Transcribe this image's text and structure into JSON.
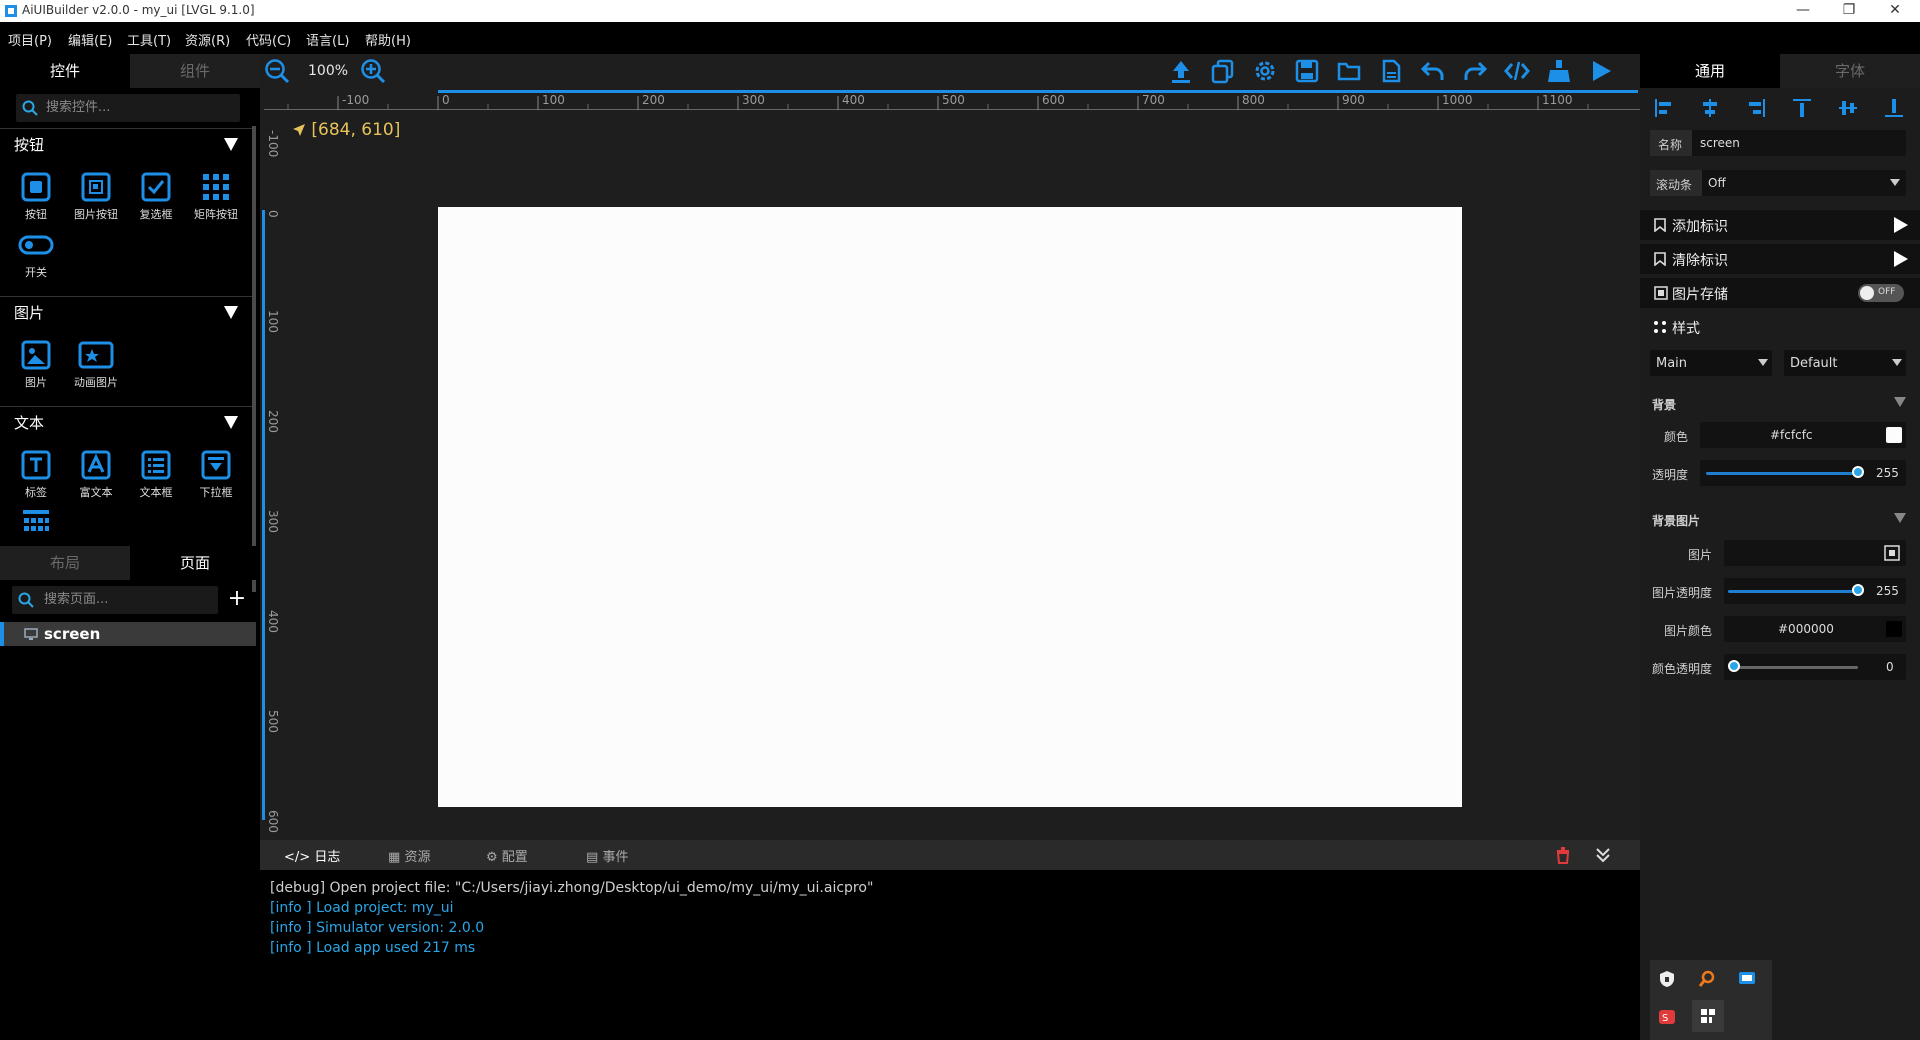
{
  "window": {
    "title": "AiUIBuilder v2.0.0 - my_ui [LVGL 9.1.0]"
  },
  "menu": [
    "项目(P)",
    "编辑(E)",
    "工具(T)",
    "资源(R)",
    "代码(C)",
    "语言(L)",
    "帮助(H)"
  ],
  "left": {
    "tabs": [
      "控件",
      "组件"
    ],
    "search_placeholder": "搜索控件...",
    "sections": [
      {
        "title": "按钮",
        "items": [
          "按钮",
          "图片按钮",
          "复选框",
          "矩阵按钮",
          "开关"
        ]
      },
      {
        "title": "图片",
        "items": [
          "图片",
          "动画图片"
        ]
      },
      {
        "title": "文本",
        "items": [
          "标签",
          "富文本",
          "文本框",
          "下拉框"
        ]
      }
    ],
    "bottom_tabs": [
      "布局",
      "页面"
    ],
    "page_search_placeholder": "搜索页面...",
    "pages": [
      "screen"
    ]
  },
  "toolbar": {
    "zoom": "100%"
  },
  "canvas": {
    "coordinate": "[684, 610]",
    "h_ticks": [
      "-100",
      "0",
      "100",
      "200",
      "300",
      "400",
      "500",
      "600",
      "700",
      "800",
      "900",
      "1000",
      "1100"
    ],
    "v_ticks": [
      "-100",
      "0",
      "100",
      "200",
      "300",
      "400",
      "500",
      "600"
    ],
    "background_color": "#fcfcfc"
  },
  "bottom": {
    "tabs": [
      "日志",
      "资源",
      "配置",
      "事件"
    ],
    "log": [
      {
        "level": "debug",
        "text": "[debug] Open project file: \"C:/Users/jiayi.zhong/Desktop/ui_demo/my_ui/my_ui.aicpro\""
      },
      {
        "level": "info",
        "text": "[info ] Load project: my_ui"
      },
      {
        "level": "info",
        "text": "[info ] Simulator version: 2.0.0"
      },
      {
        "level": "info",
        "text": "[info ] Load app used 217 ms"
      }
    ]
  },
  "right": {
    "tabs": [
      "通用",
      "字体"
    ],
    "name_label": "名称",
    "name_value": "screen",
    "scrollbar_label": "滚动条",
    "scrollbar_value": "Off",
    "add_flag": "添加标识",
    "clear_flag": "清除标识",
    "image_cache": "图片存储",
    "image_cache_toggle": "OFF",
    "style_title": "样式",
    "style_part": "Main",
    "style_state": "Default",
    "bg_section": "背景",
    "color_label": "颜色",
    "color_value": "#fcfcfc",
    "opacity_label": "透明度",
    "opacity_value": "255",
    "bg_image_section": "背景图片",
    "image_label": "图片",
    "image_opacity_label": "图片透明度",
    "image_opacity_value": "255",
    "image_color_label": "图片颜色",
    "image_color_value": "#000000",
    "color_opacity_label": "颜色透明度",
    "color_opacity_value": "0"
  },
  "colors": {
    "accent": "#1e8fe6",
    "panel": "#1e1e1e",
    "canvas_bg": "#fcfcfc",
    "log_info": "#2aa6e6"
  }
}
